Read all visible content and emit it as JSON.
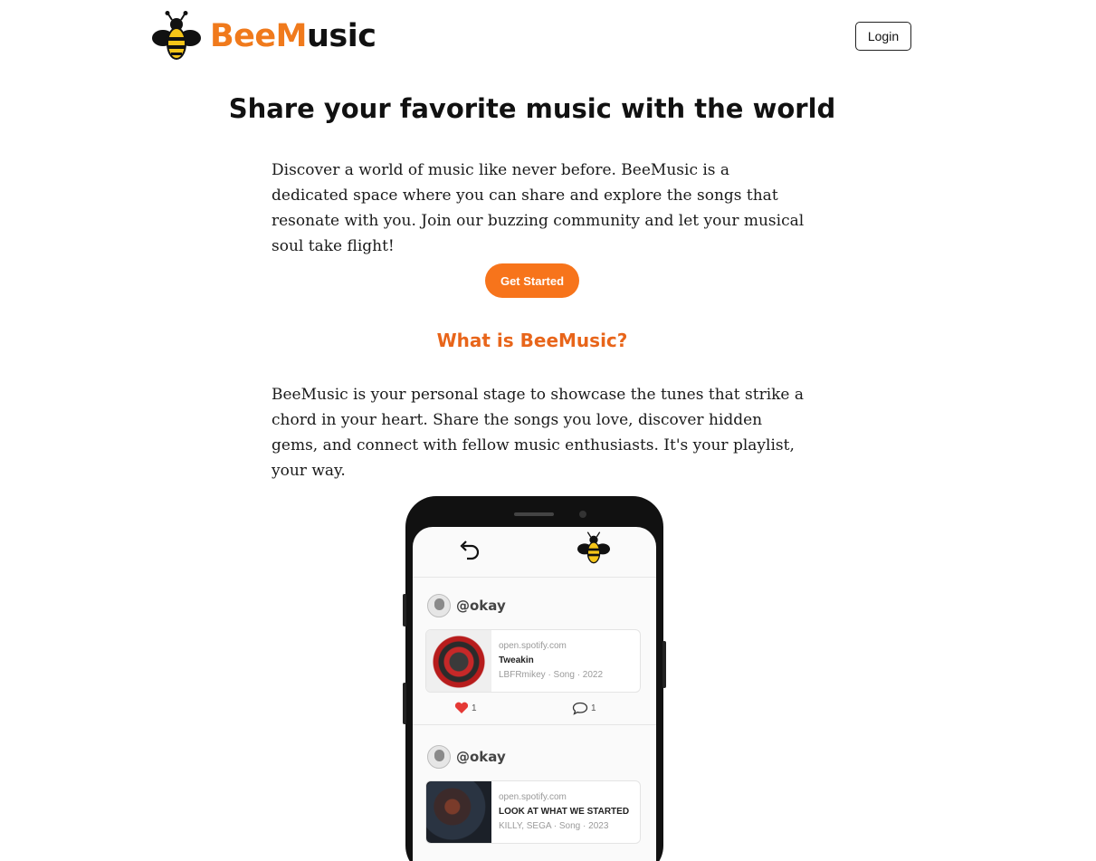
{
  "header": {
    "brand_part1": "Bee",
    "brand_part2": "M",
    "brand_part3": "usic",
    "login_label": "Login"
  },
  "hero": {
    "title": "Share your favorite music with the world",
    "description": "Discover a world of music like never before. BeeMusic is a dedicated space where you can share and explore the songs that resonate with you. Join our buzzing community and let your musical soul take flight!",
    "cta_label": "Get Started"
  },
  "about": {
    "title": "What is BeeMusic?",
    "description": "BeeMusic is your personal stage to showcase the tunes that strike a chord in your heart. Share the songs you love, discover hidden gems, and connect with fellow music enthusiasts. It's your playlist, your way."
  },
  "phone": {
    "posts": [
      {
        "username": "@okay",
        "domain": "open.spotify.com",
        "song": "Tweakin",
        "meta": "LBFRmikey · Song · 2022",
        "likes": "1",
        "comments": "1"
      },
      {
        "username": "@okay",
        "domain": "open.spotify.com",
        "song": "LOOK AT WHAT WE STARTED",
        "meta": "KILLY, SEGA · Song · 2023"
      }
    ]
  },
  "icons": {
    "logo": "bee-icon",
    "back": "back-arrow-icon",
    "like": "heart-icon",
    "comment": "comment-icon"
  },
  "colors": {
    "accent": "#f7741b",
    "section_title": "#e8651a",
    "like_heart": "#e53935"
  }
}
